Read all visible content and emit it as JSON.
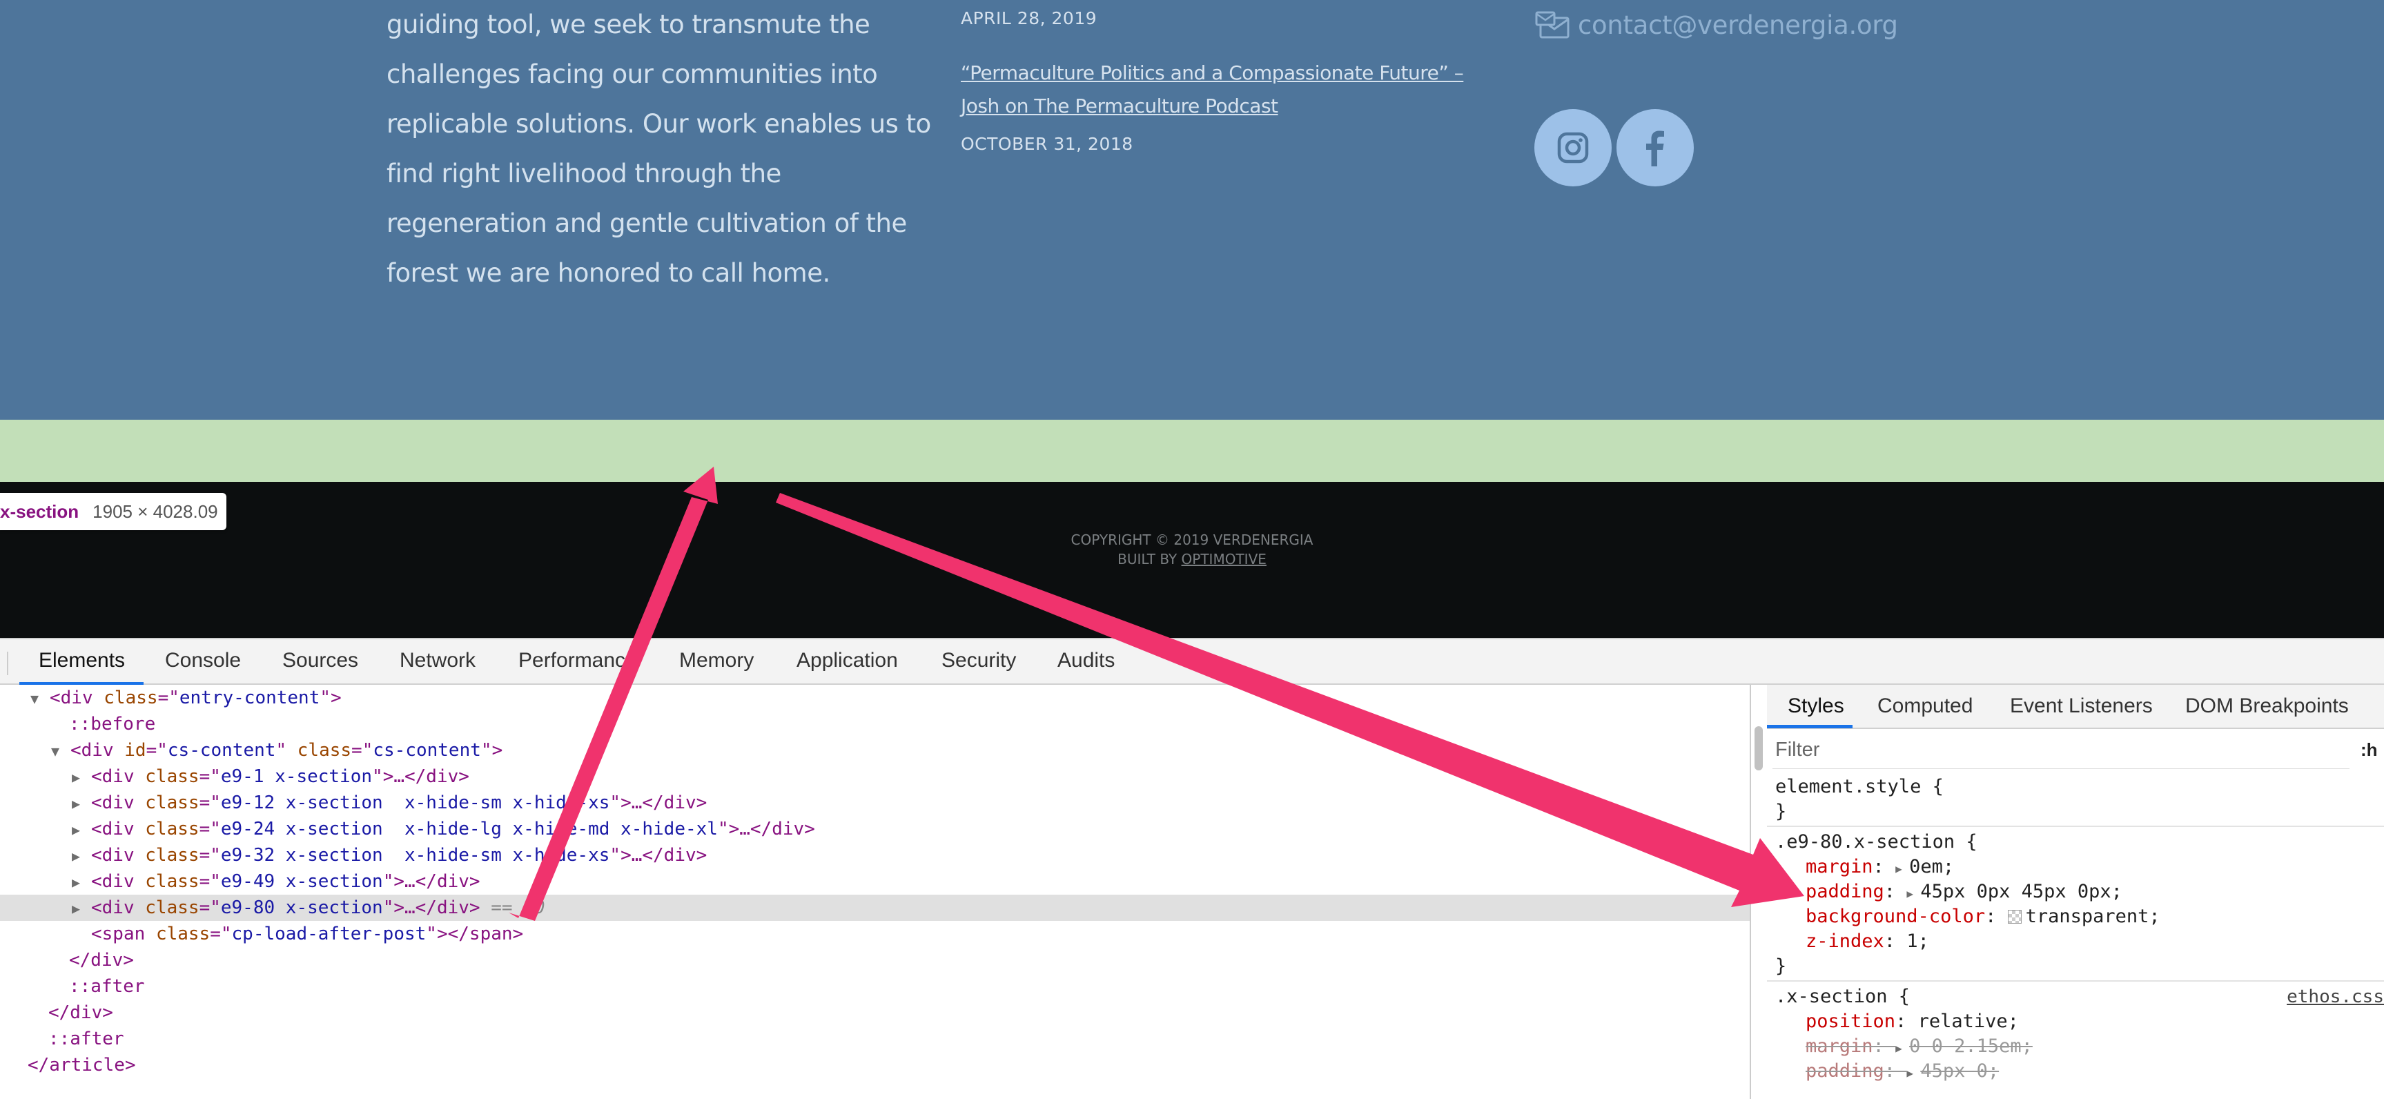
{
  "site": {
    "about_lines": [
      "guiding tool, we seek to transmute the",
      "challenges facing our communities into",
      "replicable solutions. Our work enables us to",
      "find right livelihood through the",
      "regeneration and gentle cultivation of the",
      "forest we are honored to call home."
    ],
    "post_date_1": "APRIL 28, 2019",
    "post_link_lines": [
      "“Permaculture Politics and a Compassionate Future” –",
      "Josh on The Permaculture Podcast"
    ],
    "post_date_2": "OCTOBER 31, 2018",
    "contact_email": "contact@verdenergia.org",
    "social": {
      "instagram": "instagram-icon",
      "facebook": "facebook-icon"
    },
    "copyright": "COPYRIGHT © 2019 VERDENERGIA",
    "built_by_prefix": "BUILT BY ",
    "built_by_link": "OPTIMOTIVE",
    "colors": {
      "blue": "#4e759b",
      "green": "#c2dfb8",
      "black": "#0c0e0f",
      "arrow": "#f0336d"
    }
  },
  "hover_tooltip": {
    "name": "x-section",
    "size": "1905 × 4028.09"
  },
  "devtools": {
    "tabs": [
      "Elements",
      "Console",
      "Sources",
      "Network",
      "Performance",
      "Memory",
      "Application",
      "Security",
      "Audits"
    ],
    "active_tab": "Elements",
    "dom": {
      "l1": {
        "tag_open": "<div",
        "attr": "class",
        "val": "entry-content",
        "close": ">"
      },
      "l2": "::before",
      "l3": {
        "tag_open": "<div",
        "a1": "id",
        "v1": "cs-content",
        "a2": "class",
        "v2": "cs-content",
        "close": ">"
      },
      "l4": {
        "val": "e9-1 x-section",
        "tail": "…</div>"
      },
      "l5": {
        "val": "e9-12 x-section  x-hide-sm x-hide-xs",
        "tail": "…</div>"
      },
      "l6": {
        "val": "e9-24 x-section  x-hide-lg x-hide-md x-hide-xl",
        "tail": "…</div>"
      },
      "l7": {
        "val": "e9-32 x-section  x-hide-sm x-hide-xs",
        "tail": "…</div>"
      },
      "l8": {
        "val": "e9-49 x-section",
        "tail": "…</div>"
      },
      "l9": {
        "val": "e9-80 x-section",
        "tail": "…</div>",
        "eq": " == $0"
      },
      "l10": {
        "tag_open": "<span",
        "attr": "class",
        "val": "cp-load-after-post",
        "tail": "></span>"
      },
      "l11": "</div>",
      "l12": "::after",
      "l13": "</div>",
      "l14": "::after",
      "l15": "</article>",
      "div_open": "<div",
      "class_attr": "class",
      "close": ">"
    },
    "styles_tabs": [
      "Styles",
      "Computed",
      "Event Listeners",
      "DOM Breakpoints"
    ],
    "filter_placeholder": "Filter",
    "filter_hov": ":h",
    "element_style": {
      "selector": "element.style {",
      "close": "}"
    },
    "rule1": {
      "selector": ".e9-80.x-section {",
      "margin": {
        "prop": "margin",
        "val": "0em;"
      },
      "padding": {
        "prop": "padding",
        "val": "45px 0px 45px 0px;"
      },
      "bg": {
        "prop": "background-color",
        "val": "transparent;"
      },
      "z": {
        "prop": "z-index",
        "val": "1;"
      },
      "close": "}"
    },
    "rule2": {
      "selector": ".x-section {",
      "source": "ethos.css",
      "position": {
        "prop": "position",
        "val": "relative;"
      },
      "margin": {
        "prop": "margin",
        "val": "0 0 2.15em;"
      },
      "padding": {
        "prop": "padding",
        "val": "45px 0;"
      }
    }
  }
}
